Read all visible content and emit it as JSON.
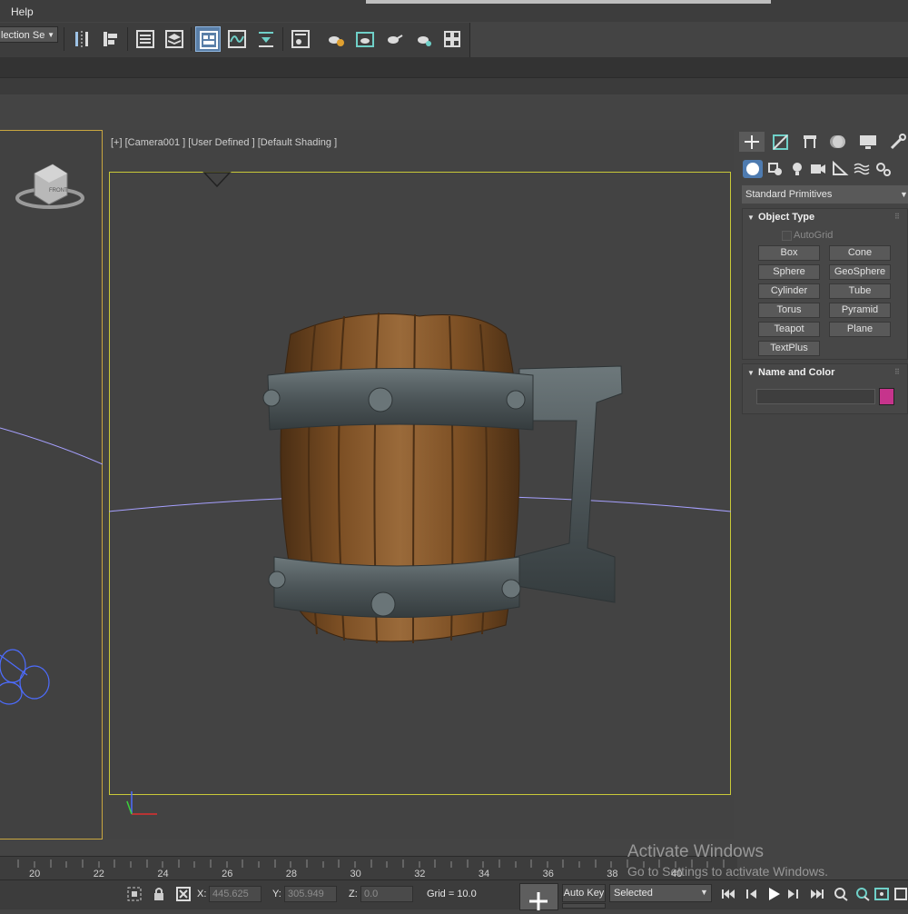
{
  "menu": {
    "help": "Help"
  },
  "toolbar": {
    "selection_set": "lection Se",
    "selection_set_arrow": "▼"
  },
  "viewport": {
    "label": "[+] [Camera001 ] [User Defined ] [Default Shading ]",
    "viewcube_text": "FRONT"
  },
  "command_panel": {
    "category": "Standard Primitives",
    "category_arrow": "▼",
    "object_type_title": "Object Type",
    "autogrid_label": "AutoGrid",
    "primitives": [
      "Box",
      "Cone",
      "Sphere",
      "GeoSphere",
      "Cylinder",
      "Tube",
      "Torus",
      "Pyramid",
      "Teapot",
      "Plane",
      "TextPlus"
    ],
    "name_color_title": "Name and Color",
    "object_color": "#c6348c"
  },
  "timeline": {
    "ticks": [
      "20",
      "22",
      "24",
      "26",
      "28",
      "30",
      "32",
      "34",
      "36",
      "38",
      "40"
    ]
  },
  "status": {
    "x_label": "X:",
    "x_value": "445.625",
    "y_label": "Y:",
    "y_value": "305.949",
    "z_label": "Z:",
    "z_value": "0.0",
    "grid": "Grid = 10.0",
    "auto_key": "Auto Key",
    "key_filter": "Selected",
    "key_filter_arrow": "▼"
  },
  "watermark": {
    "title": "Activate Windows",
    "subtitle": "Go to Settings to activate Windows."
  },
  "colors": {
    "safe_frame": "#c9c938",
    "active_viewport_border": "#c9a640",
    "active_tool": "#5a7fa8",
    "wood": "#8a5a2b",
    "iron": "#4c5558"
  }
}
